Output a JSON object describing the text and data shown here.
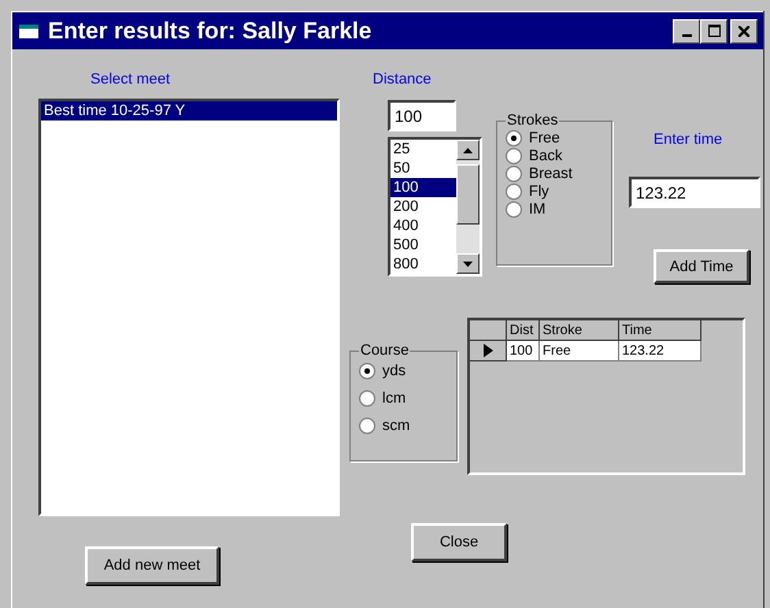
{
  "window": {
    "title": "Enter results for: Sally Farkle"
  },
  "meet": {
    "label": "Select meet",
    "items": [
      {
        "text": "Best time 10-25-97 Y",
        "selected": true
      }
    ]
  },
  "distance": {
    "label": "Distance",
    "value": "100",
    "options": [
      {
        "text": "25",
        "selected": false
      },
      {
        "text": "50",
        "selected": false
      },
      {
        "text": "100",
        "selected": true
      },
      {
        "text": "200",
        "selected": false
      },
      {
        "text": "400",
        "selected": false
      },
      {
        "text": "500",
        "selected": false
      },
      {
        "text": "800",
        "selected": false
      }
    ]
  },
  "strokes": {
    "label": "Strokes",
    "options": [
      {
        "text": "Free",
        "selected": true
      },
      {
        "text": "Back",
        "selected": false
      },
      {
        "text": "Breast",
        "selected": false
      },
      {
        "text": "Fly",
        "selected": false
      },
      {
        "text": "IM",
        "selected": false
      }
    ]
  },
  "enter_time": {
    "label": "Enter time",
    "value": "123.22",
    "button": "Add Time"
  },
  "course": {
    "label": "Course",
    "options": [
      {
        "text": "yds",
        "selected": true
      },
      {
        "text": "lcm",
        "selected": false
      },
      {
        "text": "scm",
        "selected": false
      }
    ]
  },
  "results": {
    "columns": [
      "Dist",
      "Stroke",
      "Time"
    ],
    "rows": [
      {
        "cells": [
          "100",
          "Free",
          "123.22"
        ],
        "selected": true
      }
    ]
  },
  "buttons": {
    "add_meet": "Add new meet",
    "close": "Close"
  }
}
